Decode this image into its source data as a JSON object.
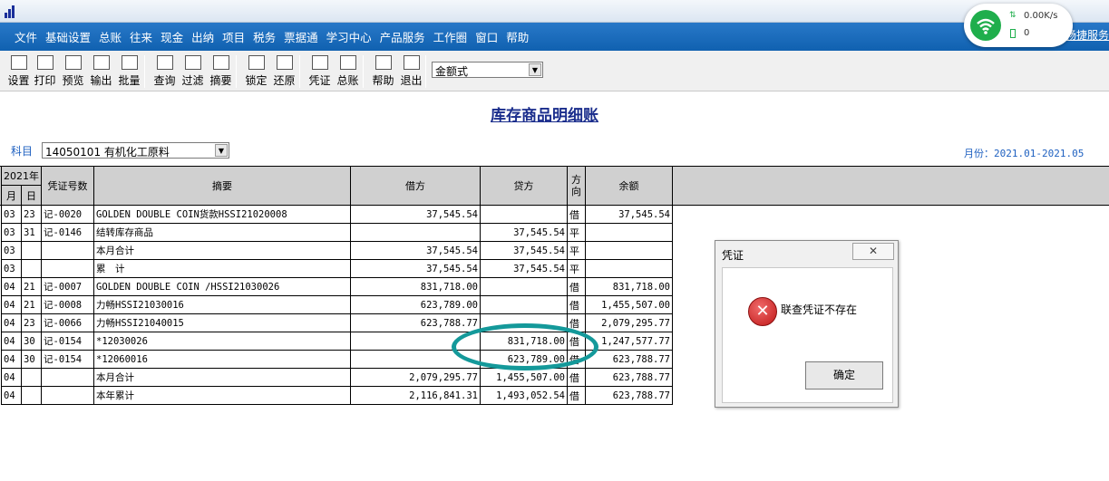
{
  "window": {
    "menu": [
      "文件",
      "基础设置",
      "总账",
      "往来",
      "现金",
      "出纳",
      "项目",
      "税务",
      "票据通",
      "学习中心",
      "产品服务",
      "工作圈",
      "窗口",
      "帮助"
    ],
    "right_link": "畅捷服务"
  },
  "toolbar": {
    "buttons": [
      {
        "label": "设置",
        "icon": "settings-icon"
      },
      {
        "label": "打印",
        "icon": "printer-icon"
      },
      {
        "label": "预览",
        "icon": "preview-icon"
      },
      {
        "label": "输出",
        "icon": "export-icon"
      },
      {
        "label": "批量",
        "icon": "batch-icon"
      },
      {
        "label": "查询",
        "icon": "binoculars-icon"
      },
      {
        "label": "过滤",
        "icon": "filter-icon"
      },
      {
        "label": "摘要",
        "icon": "summary-icon"
      },
      {
        "label": "锁定",
        "icon": "lock-icon"
      },
      {
        "label": "还原",
        "icon": "restore-icon"
      },
      {
        "label": "凭证",
        "icon": "voucher-icon"
      },
      {
        "label": "总账",
        "icon": "ledger-icon"
      },
      {
        "label": "帮助",
        "icon": "help-icon"
      },
      {
        "label": "退出",
        "icon": "exit-icon"
      }
    ],
    "format_select": "金额式"
  },
  "report": {
    "title": "库存商品明细账",
    "subject_label": "科目",
    "subject_value": "14050101 有机化工原料",
    "period": "月份：2021.01-2021.05",
    "year_header": "2021年",
    "col_month": "月",
    "col_day": "日",
    "col_voucher": "凭证号数",
    "col_summary": "摘要",
    "col_debit": "借方",
    "col_credit": "贷方",
    "col_direction": "方向",
    "col_balance": "余额",
    "rows": [
      {
        "m": "03",
        "d": "23",
        "v": "记-0020",
        "s": "GOLDEN DOUBLE COIN货款HSSI21020008",
        "debit": "37,545.54",
        "credit": "",
        "dir": "借",
        "bal": "37,545.54"
      },
      {
        "m": "03",
        "d": "31",
        "v": "记-0146",
        "s": "结转库存商品",
        "debit": "",
        "credit": "37,545.54",
        "dir": "平",
        "bal": ""
      },
      {
        "m": "03",
        "d": "",
        "v": "",
        "s": "本月合计",
        "debit": "37,545.54",
        "credit": "37,545.54",
        "dir": "平",
        "bal": ""
      },
      {
        "m": "03",
        "d": "",
        "v": "",
        "s": "累　计",
        "debit": "37,545.54",
        "credit": "37,545.54",
        "dir": "平",
        "bal": ""
      },
      {
        "m": "04",
        "d": "21",
        "v": "记-0007",
        "s": "GOLDEN DOUBLE COIN /HSSI21030026",
        "debit": "831,718.00",
        "credit": "",
        "dir": "借",
        "bal": "831,718.00"
      },
      {
        "m": "04",
        "d": "21",
        "v": "记-0008",
        "s": "力畅HSSI21030016",
        "debit": "623,789.00",
        "credit": "",
        "dir": "借",
        "bal": "1,455,507.00"
      },
      {
        "m": "04",
        "d": "23",
        "v": "记-0066",
        "s": "力畅HSSI21040015",
        "debit": "623,788.77",
        "credit": "",
        "dir": "借",
        "bal": "2,079,295.77"
      },
      {
        "m": "04",
        "d": "30",
        "v": "记-0154",
        "s": "*12030026",
        "debit": "",
        "credit": "831,718.00",
        "dir": "借",
        "bal": "1,247,577.77"
      },
      {
        "m": "04",
        "d": "30",
        "v": "记-0154",
        "s": "*12060016",
        "debit": "",
        "credit": "623,789.00",
        "dir": "借",
        "bal": "623,788.77"
      },
      {
        "m": "04",
        "d": "",
        "v": "",
        "s": "本月合计",
        "debit": "2,079,295.77",
        "credit": "1,455,507.00",
        "dir": "借",
        "bal": "623,788.77"
      },
      {
        "m": "04",
        "d": "",
        "v": "",
        "s": "本年累计",
        "debit": "2,116,841.31",
        "credit": "1,493,052.54",
        "dir": "借",
        "bal": "623,788.77"
      }
    ]
  },
  "dialog": {
    "title": "凭证",
    "close": "✕",
    "message": "联查凭证不存在",
    "ok": "确定"
  },
  "network": {
    "speed": "0.00K/s",
    "connections": "0"
  }
}
